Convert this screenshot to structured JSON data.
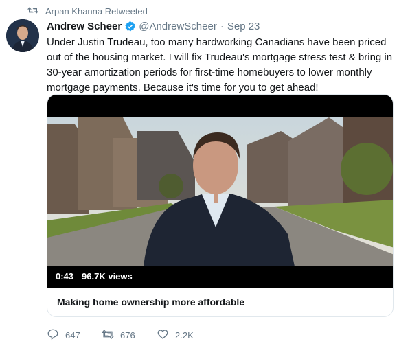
{
  "retweet_context": {
    "text": "Arpan Khanna Retweeted",
    "icon": "retweet-icon"
  },
  "tweet": {
    "display_name": "Andrew Scheer",
    "handle": "@AndrewScheer",
    "separator": "·",
    "date": "Sep 23",
    "verified": true,
    "text": "Under Justin Trudeau, too many hardworking Canadians have been priced out of the housing market. I will fix Trudeau's mortgage stress test & bring in 30-year amortization periods for first-time homebuyers to lower monthly mortgage payments. Because it's time for you to get ahead!"
  },
  "media": {
    "duration": "0:43",
    "views": "96.7K views",
    "title": "Making home ownership more affordable"
  },
  "actions": {
    "replies": "647",
    "retweets": "676",
    "likes": "2.2K"
  },
  "colors": {
    "accent": "#1da1f2",
    "muted": "#657786",
    "text": "#14171a"
  }
}
